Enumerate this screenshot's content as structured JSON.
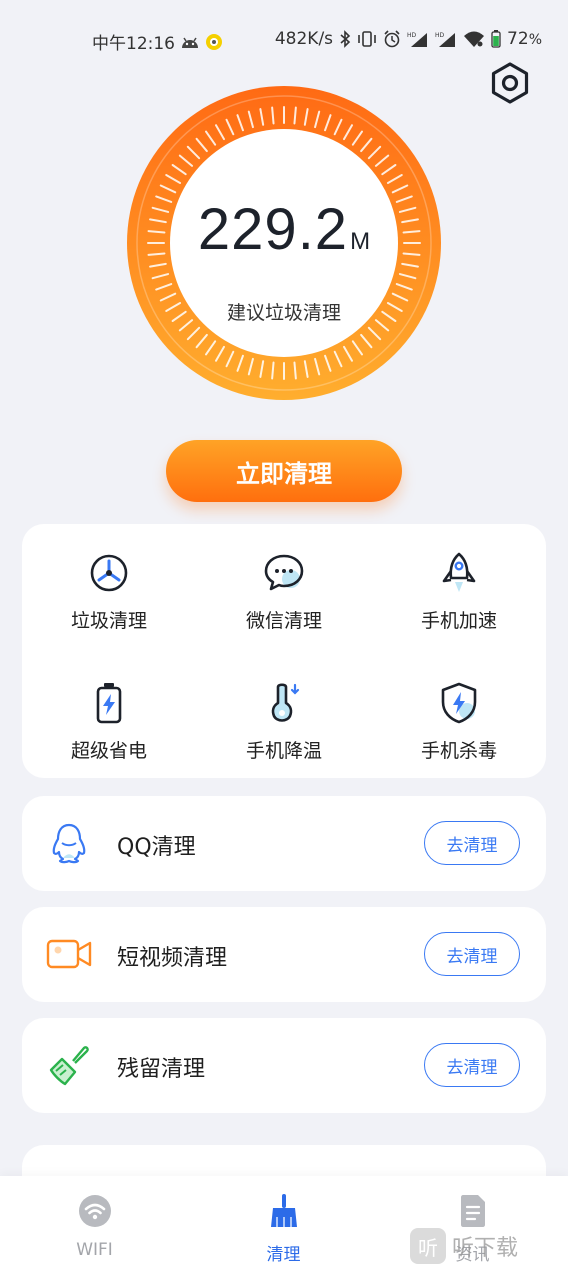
{
  "status_bar": {
    "time": "中午12:16",
    "network_speed": "482K/s",
    "battery": "72",
    "battery_unit": "%",
    "hd_label": "HD",
    "icons": [
      "android-icon",
      "notification-dot-icon",
      "bluetooth-icon",
      "vibrate-icon",
      "alarm-icon",
      "signal-hd-icon",
      "signal-hd-icon",
      "wifi-icon",
      "battery-icon"
    ]
  },
  "settings": {
    "icon": "settings-hex-icon"
  },
  "gauge": {
    "value": "229.2",
    "unit": "M",
    "caption": "建议垃圾清理",
    "colors": {
      "ring_top": "#ff7a1a",
      "ring_bottom": "#ffb030"
    }
  },
  "clean_button": {
    "label": "立即清理"
  },
  "features": [
    {
      "label": "垃圾清理",
      "icon": "trash-clock-icon"
    },
    {
      "label": "微信清理",
      "icon": "chat-bubble-icon"
    },
    {
      "label": "手机加速",
      "icon": "rocket-icon"
    },
    {
      "label": "超级省电",
      "icon": "battery-bolt-icon"
    },
    {
      "label": "手机降温",
      "icon": "thermometer-icon"
    },
    {
      "label": "手机杀毒",
      "icon": "shield-bolt-icon"
    }
  ],
  "list": [
    {
      "label": "QQ清理",
      "button": "去清理",
      "icon": "qq-penguin-icon"
    },
    {
      "label": "短视频清理",
      "button": "去清理",
      "icon": "video-camera-icon"
    },
    {
      "label": "残留清理",
      "button": "去清理",
      "icon": "broom-icon"
    }
  ],
  "nav": [
    {
      "label": "WIFI",
      "icon": "wifi-icon",
      "active": false
    },
    {
      "label": "清理",
      "icon": "broom-icon",
      "active": true
    },
    {
      "label": "资讯",
      "icon": "document-icon",
      "active": false
    }
  ],
  "watermark": {
    "text": "听下载",
    "logo": "听"
  },
  "colors": {
    "accent": "#2c6be8",
    "button_blue": "#3a79f3",
    "orange": "#ff7a1a",
    "background": "#f1f2f7"
  }
}
